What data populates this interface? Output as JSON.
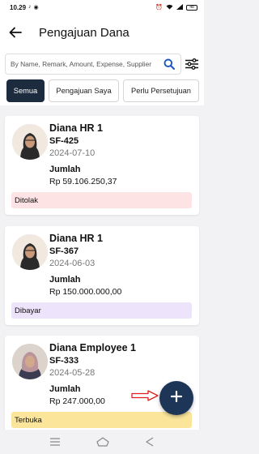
{
  "status_bar": {
    "time": "10.29",
    "notification_icons": [
      "tiktok-icon",
      "record-icon"
    ],
    "battery": "48"
  },
  "header": {
    "title": "Pengajuan Dana"
  },
  "search": {
    "placeholder": "By Name, Remark, Amount, Expense, Supplier"
  },
  "tabs": [
    {
      "label": "Semua",
      "active": true
    },
    {
      "label": "Pengajuan Saya",
      "active": false
    },
    {
      "label": "Perlu Persetujuan",
      "active": false
    }
  ],
  "requests": [
    {
      "name": "Diana HR 1",
      "code": "SF-425",
      "date": "2024-07-10",
      "amount_label": "Jumlah",
      "amount": "Rp 59.106.250,37",
      "status": "Ditolak",
      "status_color": "#fde3e3"
    },
    {
      "name": "Diana HR 1",
      "code": "SF-367",
      "date": "2024-06-03",
      "amount_label": "Jumlah",
      "amount": "Rp 150.000.000,00",
      "status": "Dibayar",
      "status_color": "#ede3fa"
    },
    {
      "name": "Diana Employee 1",
      "code": "SF-333",
      "date": "2024-05-28",
      "amount_label": "Jumlah",
      "amount": "Rp 247.000,00",
      "status": "Terbuka",
      "status_color": "#fbe59a"
    }
  ],
  "colors": {
    "primary": "#1d3557",
    "chip_active": "#1d2b3e",
    "accent_blue": "#1a56c4",
    "annotation_red": "#e02020"
  },
  "icons": {
    "back": "arrow-left-icon",
    "search": "search-icon",
    "filter": "filter-sliders-icon",
    "fab": "plus-icon"
  }
}
